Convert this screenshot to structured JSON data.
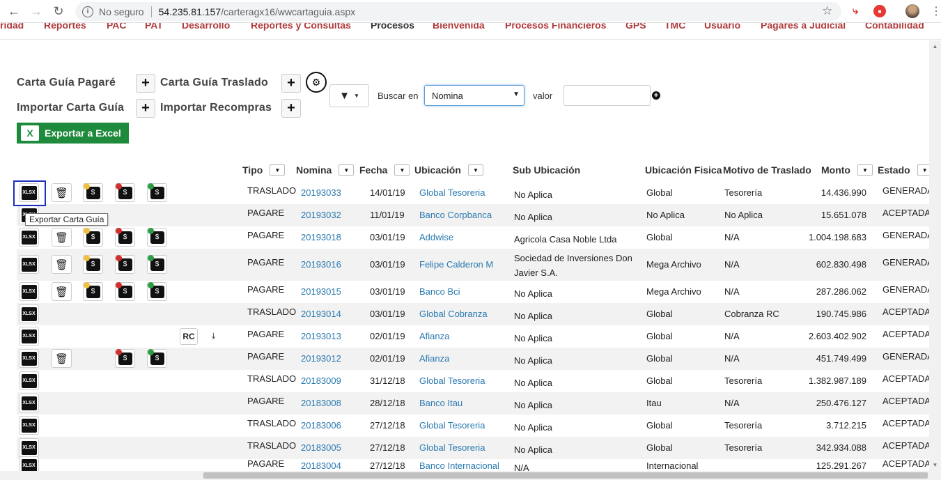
{
  "browser": {
    "security": "No seguro",
    "url_host": "54.235.81.157",
    "url_path": "/carteragx16/wwcartaguia.aspx"
  },
  "menu": [
    "ridad",
    "Reportes",
    "PAC",
    "PAT",
    "Desarrollo",
    "Reportes y Consultas",
    "Procesos",
    "Bienvenida",
    "Procesos Financieros",
    "GPS",
    "TMC",
    "Usuario",
    "Pagares a Judicial",
    "Contabilidad"
  ],
  "toolbar": {
    "carta_pagare": "Carta Guía Pagaré",
    "carta_traslado": "Carta Guía Traslado",
    "importar_carta": "Importar Carta Guía",
    "importar_recompras": "Importar Recompras",
    "buscar_en": "Buscar en",
    "buscar_select": "Nomina",
    "valor": "valor",
    "valor_value": "",
    "exportar": "Exportar a Excel"
  },
  "grid": {
    "headers": {
      "tipo": "Tipo",
      "nomina": "Nomina",
      "fecha": "Fecha",
      "ubicacion": "Ubicación",
      "sub_ubicacion": "Sub Ubicación",
      "ubicacion_fisica": "Ubicación Fisica",
      "motivo": "Motivo de Traslado",
      "monto": "Monto",
      "estado": "Estado"
    },
    "rows": [
      {
        "tipo": "TRASLADO",
        "nomina": "20193033",
        "fecha": "14/01/19",
        "ubicacion": "Global Tesoreria",
        "sub": "No Aplica",
        "sub2": "",
        "fisica": "Global",
        "motivo": "Tesorería",
        "monto": "14.436.990",
        "estado": "GENERADA"
      },
      {
        "tipo": "PAGARE",
        "nomina": "20193032",
        "fecha": "11/01/19",
        "ubicacion": "Banco Corpbanca",
        "sub": "No Aplica",
        "sub2": "",
        "fisica": "No Aplica",
        "motivo": "No Aplica",
        "monto": "15.651.078",
        "estado": "ACEPTADA"
      },
      {
        "tipo": "PAGARE",
        "nomina": "20193018",
        "fecha": "03/01/19",
        "ubicacion": "Addwise",
        "sub": "Agricola Casa Noble Ltda",
        "sub2": "",
        "fisica": "Global",
        "motivo": "N/A",
        "monto": "1.004.198.683",
        "estado": "GENERADA"
      },
      {
        "tipo": "PAGARE",
        "nomina": "20193016",
        "fecha": "03/01/19",
        "ubicacion": "Felipe Calderon M",
        "sub": "Sociedad de Inversiones Don",
        "sub2": "Javier S.A.",
        "fisica": "Mega Archivo",
        "motivo": "N/A",
        "monto": "602.830.498",
        "estado": "GENERADA"
      },
      {
        "tipo": "PAGARE",
        "nomina": "20193015",
        "fecha": "03/01/19",
        "ubicacion": "Banco Bci",
        "sub": "No Aplica",
        "sub2": "",
        "fisica": "Mega Archivo",
        "motivo": "N/A",
        "monto": "287.286.062",
        "estado": "GENERADA"
      },
      {
        "tipo": "TRASLADO",
        "nomina": "20193014",
        "fecha": "03/01/19",
        "ubicacion": "Global Cobranza",
        "sub": "No Aplica",
        "sub2": "",
        "fisica": "Global",
        "motivo": "Cobranza RC",
        "monto": "190.745.986",
        "estado": "ACEPTADA"
      },
      {
        "tipo": "PAGARE",
        "nomina": "20193013",
        "fecha": "02/01/19",
        "ubicacion": "Afianza",
        "sub": "No Aplica",
        "sub2": "",
        "fisica": "Global",
        "motivo": "N/A",
        "monto": "2.603.402.902",
        "estado": "ACEPTADA"
      },
      {
        "tipo": "PAGARE",
        "nomina": "20193012",
        "fecha": "02/01/19",
        "ubicacion": "Afianza",
        "sub": "No Aplica",
        "sub2": "",
        "fisica": "Global",
        "motivo": "N/A",
        "monto": "451.749.499",
        "estado": "GENERADA"
      },
      {
        "tipo": "TRASLADO",
        "nomina": "20183009",
        "fecha": "31/12/18",
        "ubicacion": "Global Tesoreria",
        "sub": "No Aplica",
        "sub2": "",
        "fisica": "Global",
        "motivo": "Tesorería",
        "monto": "1.382.987.189",
        "estado": "ACEPTADA"
      },
      {
        "tipo": "PAGARE",
        "nomina": "20183008",
        "fecha": "28/12/18",
        "ubicacion": "Banco Itau",
        "sub": "No Aplica",
        "sub2": "",
        "fisica": "Itau",
        "motivo": "N/A",
        "monto": "250.476.127",
        "estado": "ACEPTADA"
      },
      {
        "tipo": "TRASLADO",
        "nomina": "20183006",
        "fecha": "27/12/18",
        "ubicacion": "Global Tesoreria",
        "sub": "No Aplica",
        "sub2": "",
        "fisica": "Global",
        "motivo": "Tesorería",
        "monto": "3.712.215",
        "estado": "ACEPTADA"
      },
      {
        "tipo": "TRASLADO",
        "nomina": "20183005",
        "fecha": "27/12/18",
        "ubicacion": "Global Tesoreria",
        "sub": "No Aplica",
        "sub2": "",
        "fisica": "Global",
        "motivo": "Tesorería",
        "monto": "342.934.088",
        "estado": "ACEPTADA"
      },
      {
        "tipo": "PAGARE",
        "nomina": "20183004",
        "fecha": "27/12/18",
        "ubicacion": "Banco Internacional",
        "sub": "N/A",
        "sub2": "",
        "fisica": "Internacional",
        "motivo": "",
        "monto": "125.291.267",
        "estado": "ACEPTADA"
      }
    ],
    "row_actions": [
      [
        "xlsx",
        "trash",
        "money-add",
        "money-remove",
        "money-ok"
      ],
      [
        "xlsx"
      ],
      [
        "xlsx",
        "trash",
        "money-add",
        "money-remove",
        "money-ok"
      ],
      [
        "xlsx",
        "trash",
        "money-add",
        "money-remove",
        "money-ok"
      ],
      [
        "xlsx",
        "trash",
        "money-add",
        "money-remove",
        "money-ok"
      ],
      [
        "xlsx"
      ],
      [
        "xlsx",
        "rc",
        "download"
      ],
      [
        "xlsx",
        "trash",
        "money-remove",
        "money-ok"
      ],
      [
        "xlsx"
      ],
      [
        "xlsx"
      ],
      [
        "xlsx"
      ],
      [
        "xlsx"
      ],
      [
        "xlsx"
      ]
    ],
    "xlsx_label": "XLSX",
    "rc_label": "RC"
  },
  "tooltip": "Exportar Carta Guía"
}
